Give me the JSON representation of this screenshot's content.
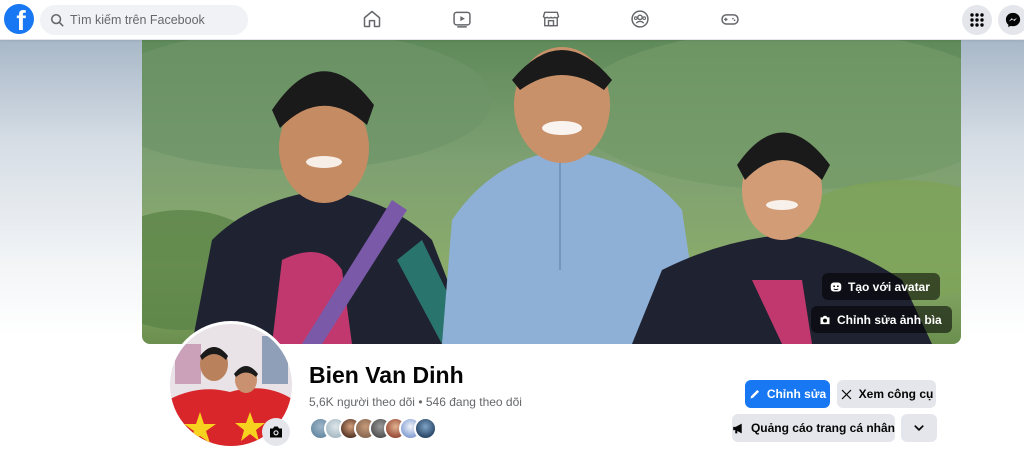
{
  "header": {
    "logo_icon": "facebook-logo-icon",
    "logo_letter": "f",
    "search": {
      "placeholder": "Tìm kiếm trên Facebook",
      "icon": "search-icon"
    },
    "nav_icons": [
      "home-icon",
      "video-icon",
      "marketplace-icon",
      "groups-icon",
      "gaming-icon"
    ],
    "right_icons": [
      "menu-grid-icon",
      "messenger-icon"
    ]
  },
  "cover": {
    "buttons": {
      "avatar": "Tạo với avatar",
      "edit_cover": "Chỉnh sửa ảnh bìa"
    }
  },
  "profile": {
    "name": "Bien Van Dinh",
    "followers": "5,6K người theo dõi",
    "separator": " • ",
    "following": "546 đang theo dõi",
    "friend_avatar_count": 8
  },
  "actions": {
    "edit": "Chỉnh sửa",
    "view_tools": "Xem công cụ",
    "ads": "Quảng cáo trang cá nhân"
  },
  "colors": {
    "brand": "#1877f2",
    "secondary_button": "#e4e6eb",
    "text_primary": "#050505",
    "text_secondary": "#65676b"
  }
}
